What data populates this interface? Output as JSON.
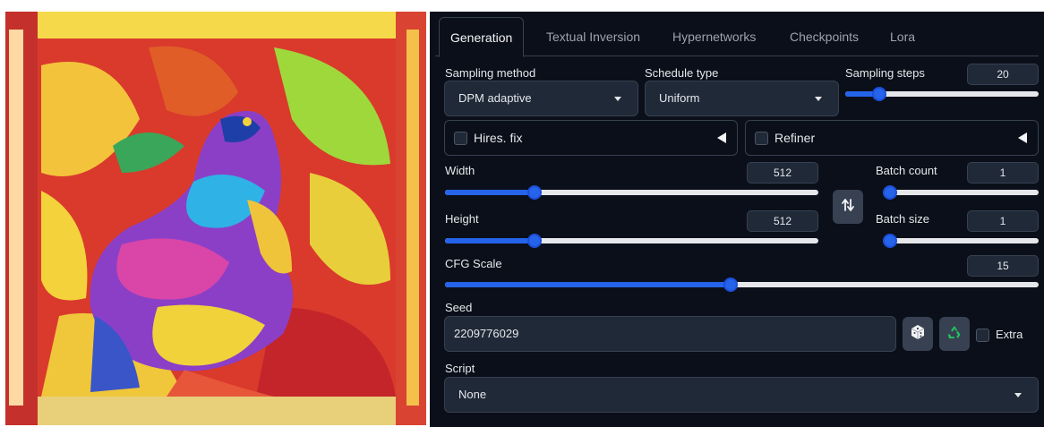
{
  "tabs": [
    "Generation",
    "Textual Inversion",
    "Hypernetworks",
    "Checkpoints",
    "Lora"
  ],
  "active_tab": "Generation",
  "sampling_method": {
    "label": "Sampling method",
    "value": "DPM adaptive"
  },
  "schedule_type": {
    "label": "Schedule type",
    "value": "Uniform"
  },
  "sampling_steps": {
    "label": "Sampling steps",
    "value": "20",
    "fraction": 0.15
  },
  "hires_fix": {
    "label": "Hires. fix",
    "checked": false
  },
  "refiner": {
    "label": "Refiner",
    "checked": false
  },
  "width": {
    "label": "Width",
    "value": "512",
    "fraction": 0.23
  },
  "height": {
    "label": "Height",
    "value": "512",
    "fraction": 0.23
  },
  "batch_count": {
    "label": "Batch count",
    "value": "1",
    "fraction": 0.0
  },
  "batch_size": {
    "label": "Batch size",
    "value": "1",
    "fraction": 0.0
  },
  "swap_icon": "swap-vertical-icon",
  "cfg_scale": {
    "label": "CFG Scale",
    "value": "15",
    "fraction": 0.48
  },
  "seed": {
    "label": "Seed",
    "value": "2209776029"
  },
  "seed_buttons": [
    "dice-icon",
    "recycle-icon"
  ],
  "extra": {
    "label": "Extra",
    "checked": false
  },
  "script": {
    "label": "Script",
    "value": "None"
  },
  "colors": {
    "background": "#0b0f19",
    "accent": "#2563eb",
    "input": "#1f2937",
    "border": "#374151"
  }
}
